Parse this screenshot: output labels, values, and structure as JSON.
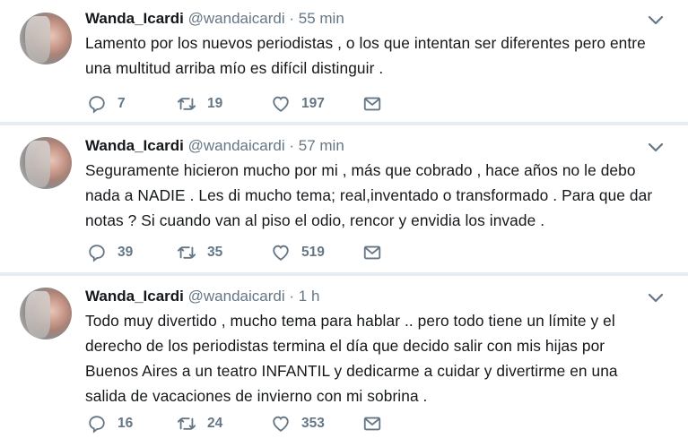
{
  "tweets": [
    {
      "name": "Wanda_Icardi",
      "handle": "@wandaicardi",
      "dot": "·",
      "time": "55 min",
      "lines": [
        "Lamento por los nuevos periodistas , o los que intentan ser diferentes pero entre",
        "una multitud arriba mío es difícil distinguir ."
      ],
      "replies": "7",
      "retweets": "19",
      "likes": "197"
    },
    {
      "name": "Wanda_Icardi",
      "handle": "@wandaicardi",
      "dot": "·",
      "time": "57 min",
      "lines": [
        "Seguramente hicieron mucho por mi , más que cobrado , hace años no le debo",
        "nada a NADIE . Les di mucho tema;  real,inventado o transformado . Para que dar",
        "notas ? Si cuando van al piso el odio, rencor y envidia los invade ."
      ],
      "replies": "39",
      "retweets": "35",
      "likes": "519"
    },
    {
      "name": "Wanda_Icardi",
      "handle": "@wandaicardi",
      "dot": "·",
      "time": "1 h",
      "lines": [
        "Todo muy divertido , mucho tema para hablar .. pero todo tiene un límite y el",
        "derecho de los periodistas termina el día que decido salir con mis hijas por",
        "Buenos Aires a un teatro INFANTIL y dedicarme a cuidar y divertirme en una",
        "salida de vacaciones de invierno con mi sobrina ."
      ],
      "replies": "16",
      "retweets": "24",
      "likes": "353"
    }
  ],
  "icons": {
    "reply": "reply-icon",
    "retweet": "retweet-icon",
    "like": "heart-icon",
    "dm": "envelope-icon",
    "menu": "chevron-down-icon"
  },
  "colors": {
    "text": "#14171a",
    "secondary": "#657786",
    "background": "#e6ecf0"
  }
}
